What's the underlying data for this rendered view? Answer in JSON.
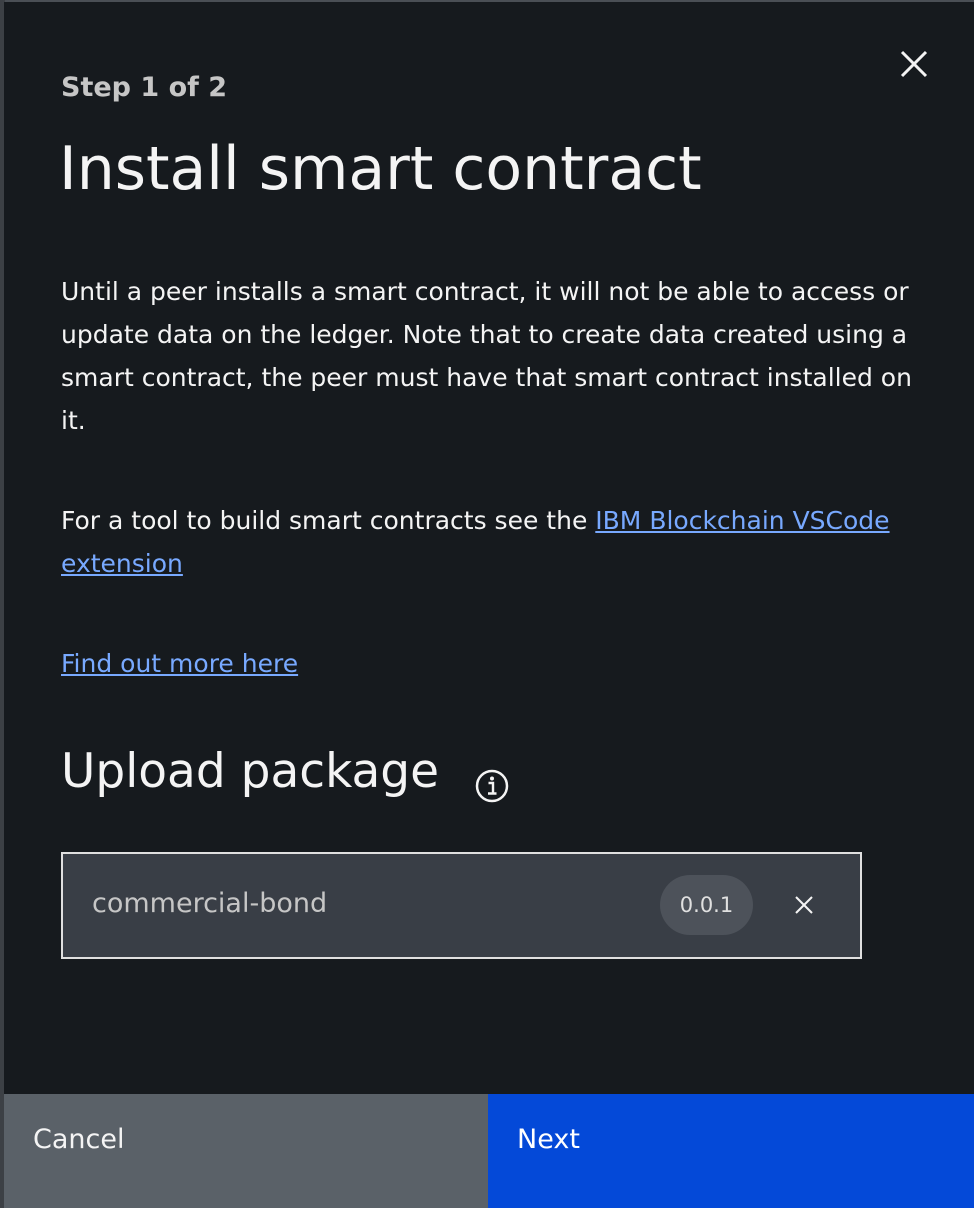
{
  "modal": {
    "step_label": "Step 1 of 2",
    "title": "Install smart contract",
    "description": "Until a peer installs a smart contract, it will not be able to access or update data on the ledger. Note that to create data created using a smart contract, the peer must have that smart contract installed on it.",
    "tool_text": "For a tool to build smart contracts see the",
    "tool_link": "IBM Blockchain VSCode extension",
    "more_link": "Find out more here",
    "upload_heading": "Upload package",
    "close_icon": "close-icon",
    "info_icon": "info-icon"
  },
  "file": {
    "name": "commercial-bond",
    "version": "0.0.1",
    "remove_icon": "close-icon"
  },
  "footer": {
    "cancel_label": "Cancel",
    "next_label": "Next"
  },
  "colors": {
    "modal_background": "#161a1e",
    "link": "#78a9ff",
    "primary_button": "#0449d8",
    "secondary_button": "#5a6168"
  }
}
